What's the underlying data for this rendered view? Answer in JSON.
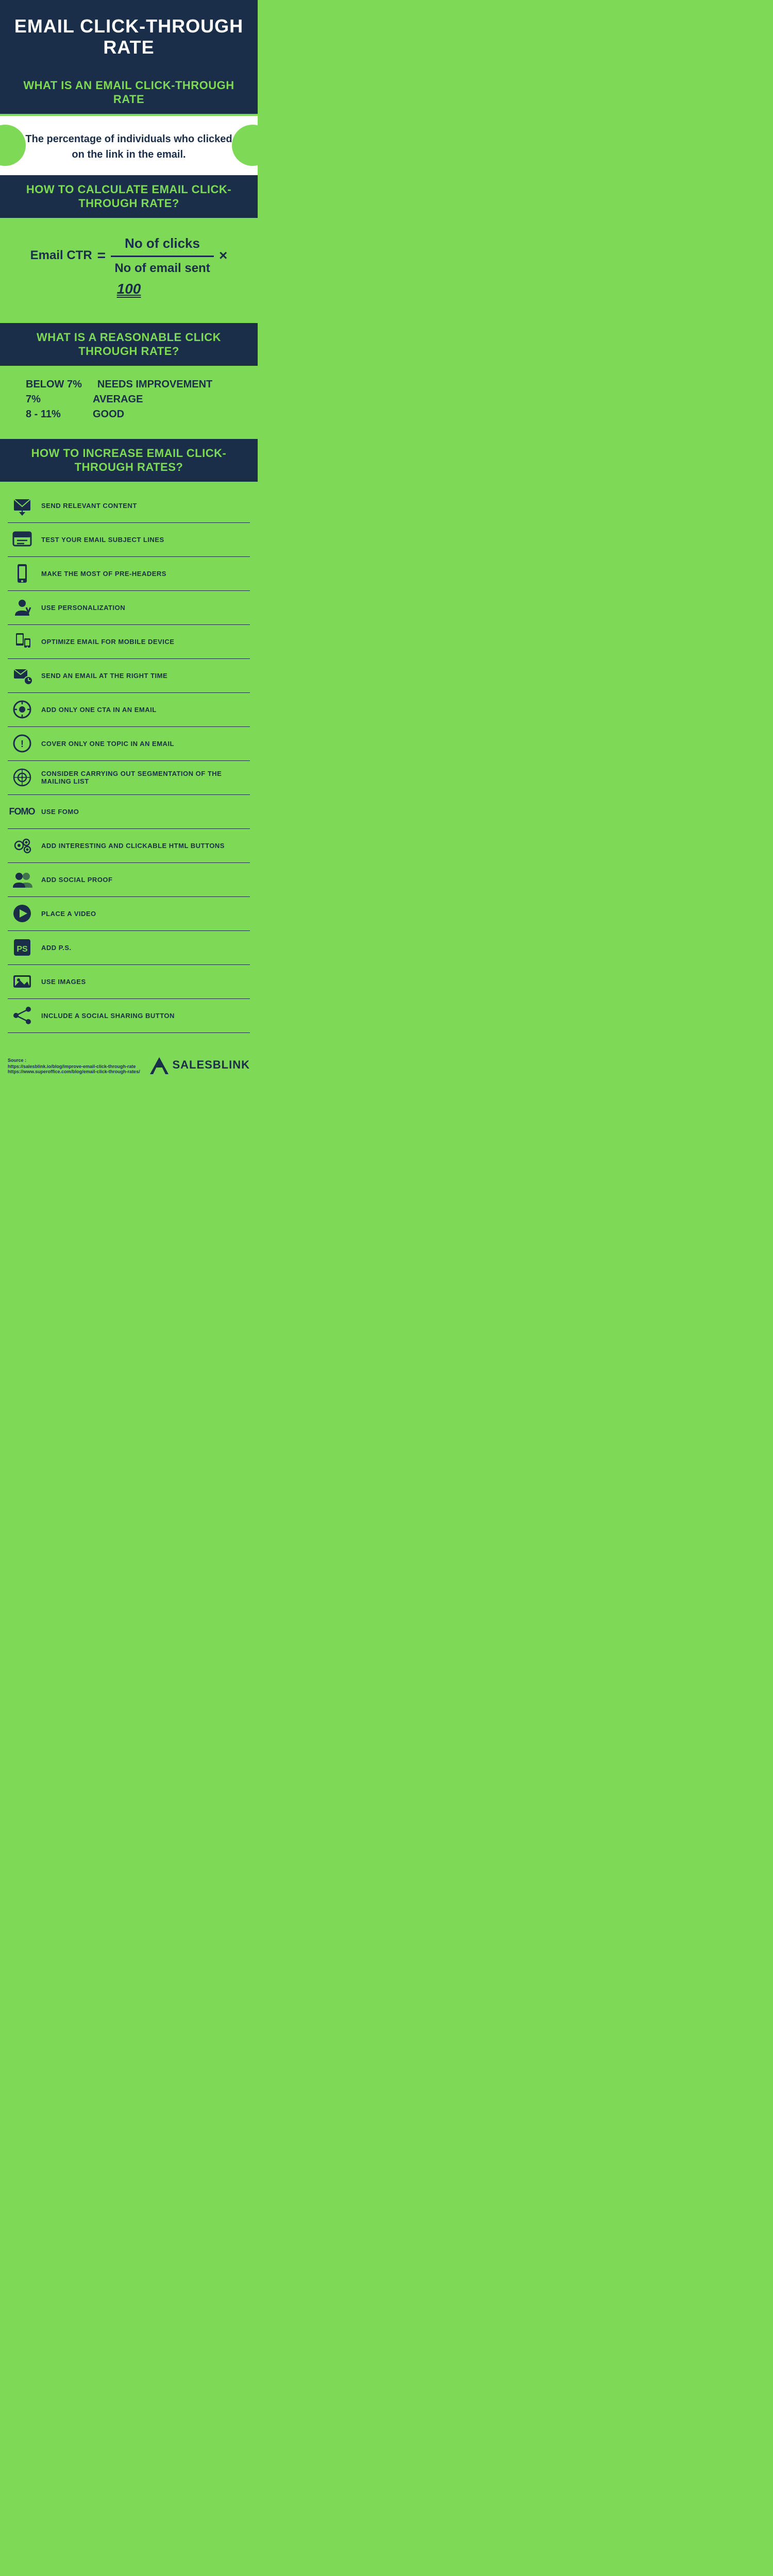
{
  "header": {
    "title": "EMAIL CLICK-THROUGH RATE"
  },
  "what_is": {
    "section_title": "WHAT IS AN EMAIL CLICK-THROUGH RATE",
    "description": "The percentage of individuals who clicked on the link in the email."
  },
  "calculate": {
    "section_title": "HOW TO CALCULATE EMAIL CLICK-THROUGH RATE?",
    "label": "Email CTR",
    "equals": "=",
    "numerator": "No of clicks",
    "multiply": "×",
    "hundred": "100",
    "denominator": "No of email sent"
  },
  "reasonable": {
    "section_title": "WHAT IS A REASONABLE CLICK THROUGH RATE?",
    "rates": [
      {
        "value": "BELOW 7%",
        "label": "NEEDS IMPROVEMENT"
      },
      {
        "value": "7%",
        "label": "AVERAGE"
      },
      {
        "value": "8 - 11%",
        "label": "GOOD"
      }
    ]
  },
  "increase": {
    "section_title": "HOW TO INCREASE EMAIL CLICK-THROUGH RATES?",
    "tips": [
      {
        "icon": "email-send",
        "text": "SEND RELEVANT CONTENT"
      },
      {
        "icon": "email-subject",
        "text": "TEST YOUR EMAIL SUBJECT LINES"
      },
      {
        "icon": "mobile-phone",
        "text": "MAKE THE MOST OF PRE-HEADERS"
      },
      {
        "icon": "personalization",
        "text": "USE PERSONALIZATION"
      },
      {
        "icon": "mobile-optimize",
        "text": "OPTIMIZE EMAIL FOR MOBILE DEVICE"
      },
      {
        "icon": "clock-email",
        "text": "SEND AN EMAIL AT THE RIGHT TIME"
      },
      {
        "icon": "cta-single",
        "text": "ADD ONLY ONE CTA IN AN EMAIL"
      },
      {
        "icon": "topic-one",
        "text": "COVER ONLY ONE TOPIC IN AN EMAIL"
      },
      {
        "icon": "segmentation",
        "text": "CONSIDER CARRYING OUT SEGMENTATION OF THE MAILING LIST"
      },
      {
        "icon": "fomo",
        "text": "USE FOMO"
      },
      {
        "icon": "html-buttons",
        "text": "ADD INTERESTING AND CLICKABLE HTML BUTTONS"
      },
      {
        "icon": "social-proof",
        "text": "ADD SOCIAL PROOF"
      },
      {
        "icon": "video",
        "text": "PLACE A VIDEO"
      },
      {
        "icon": "ps",
        "text": "ADD P.S."
      },
      {
        "icon": "images",
        "text": "USE IMAGES"
      },
      {
        "icon": "social-share",
        "text": "INCLUDE A SOCIAL SHARING BUTTON"
      }
    ]
  },
  "footer": {
    "source_label": "Source :",
    "sources": [
      "https://salesblink.io/blog/improve-email-click-through-rate",
      "https://www.superoffice.com/blog/email-click-through-rates/"
    ],
    "logo_text": "SALESBLINK"
  }
}
